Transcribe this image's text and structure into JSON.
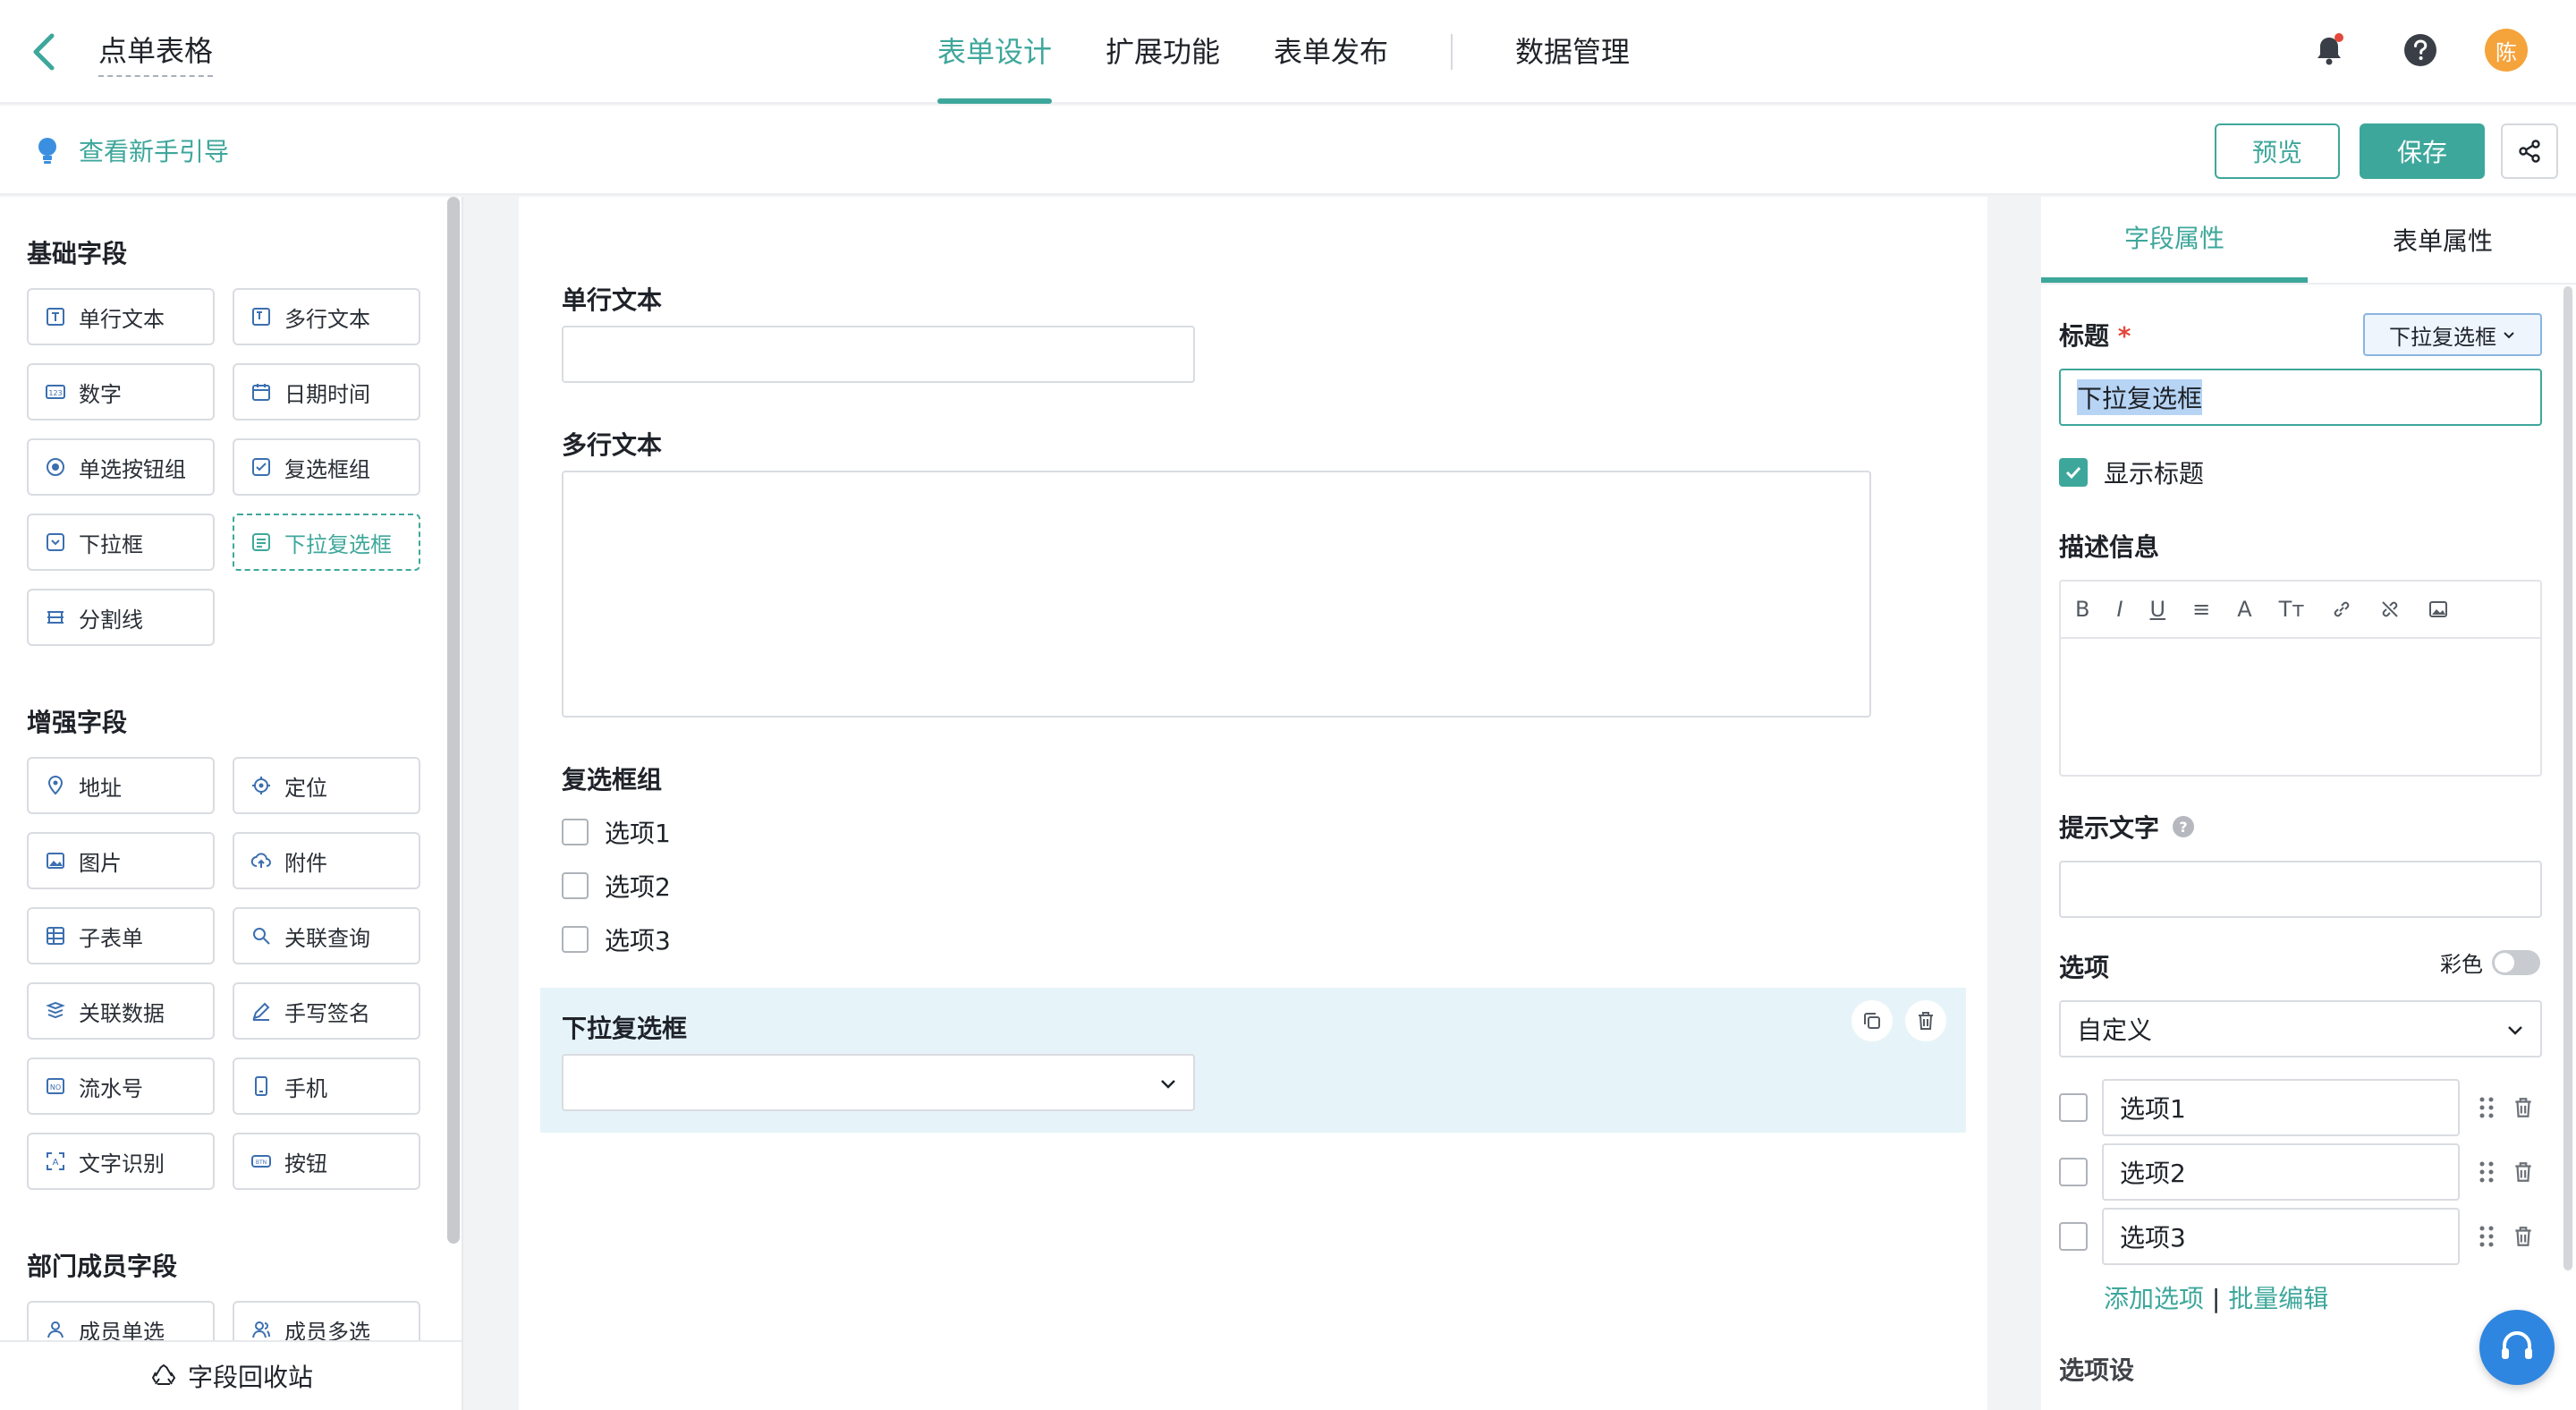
{
  "header": {
    "form_title": "点单表格",
    "tabs": [
      {
        "label": "表单设计",
        "active": true
      },
      {
        "label": "扩展功能",
        "active": false
      },
      {
        "label": "表单发布",
        "active": false
      },
      {
        "label": "数据管理",
        "active": false
      }
    ],
    "avatar_text": "陈"
  },
  "subbar": {
    "guide_label": "查看新手引导",
    "preview_label": "预览",
    "save_label": "保存"
  },
  "palette": {
    "basic_title": "基础字段",
    "basic": [
      "单行文本",
      "多行文本",
      "数字",
      "日期时间",
      "单选按钮组",
      "复选框组",
      "下拉框",
      "下拉复选框",
      "分割线"
    ],
    "enhanced_title": "增强字段",
    "enhanced": [
      "地址",
      "定位",
      "图片",
      "附件",
      "子表单",
      "关联查询",
      "关联数据",
      "手写签名",
      "流水号",
      "手机",
      "文字识别",
      "按钮"
    ],
    "member_title": "部门成员字段",
    "member": [
      "成员单选",
      "成员多选"
    ],
    "recycle_label": "字段回收站"
  },
  "canvas": {
    "single_text_label": "单行文本",
    "multi_text_label": "多行文本",
    "checkbox_group_label": "复选框组",
    "checkbox_options": [
      "选项1",
      "选项2",
      "选项3"
    ],
    "dropdown_multi_label": "下拉复选框"
  },
  "props": {
    "tab_field": "字段属性",
    "tab_form": "表单属性",
    "title_label": "标题",
    "required_mark": "*",
    "type_selector": "下拉复选框",
    "title_value": "下拉复选框",
    "show_title_label": "显示标题",
    "desc_label": "描述信息",
    "toolbar_items": [
      "B",
      "I",
      "U",
      "≡",
      "A",
      "Tт"
    ],
    "hint_label": "提示文字",
    "options_label": "选项",
    "color_label": "彩色",
    "options_source": "自定义",
    "options": [
      "选项1",
      "选项2",
      "选项3"
    ],
    "add_option": "添加选项",
    "divider": "|",
    "batch_edit": "批量编辑",
    "next_label": "选项设"
  },
  "colors": {
    "accent": "#3ea79b",
    "highlight": "#e6f4f9",
    "avatar": "#f5a33b"
  }
}
